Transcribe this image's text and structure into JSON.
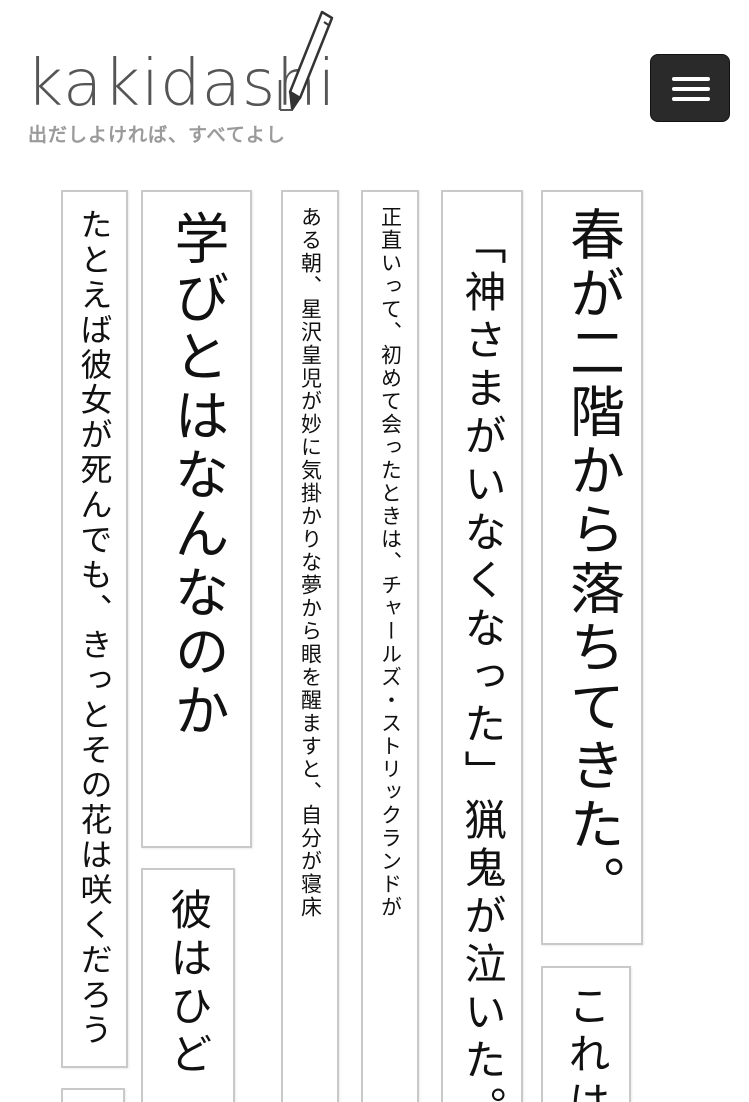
{
  "header": {
    "logo_text": "kakidashi",
    "tagline": "出だしよければ、すべてよし",
    "menu_icon": "hamburger-icon",
    "logo_icon": "pen-icon"
  },
  "cards": [
    {
      "id": "card-1",
      "text": "春が二階から落ちてきた。"
    },
    {
      "id": "card-2",
      "text": "「神さまがいなくなった」猟鬼が泣いた。"
    },
    {
      "id": "card-3",
      "text": "正直いって、初めて会ったときは、チャールズ・ストリックランドが"
    },
    {
      "id": "card-4",
      "text": "ある朝、星沢皇児が妙に気掛かりな夢から眼を醒ますと、自分が寝床"
    },
    {
      "id": "card-5",
      "text": "学びとはなんなのか"
    },
    {
      "id": "card-6",
      "text": "たとえば彼女が死んでも、きっとその花は咲くだろう"
    },
    {
      "id": "card-7",
      "text": "これは"
    },
    {
      "id": "card-8",
      "text": "彼はひど"
    },
    {
      "id": "card-9",
      "text": ""
    }
  ],
  "colors": {
    "menu_button_bg": "#2a2a2a",
    "card_border": "#c9c9c9",
    "tagline": "#9a9a9a",
    "logo": "#555555"
  }
}
